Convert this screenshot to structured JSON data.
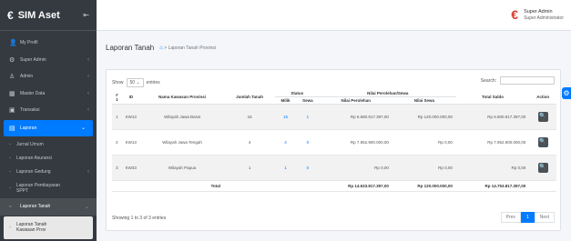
{
  "app": {
    "title": "SIM Aset",
    "logo_icon": "wallet-icon",
    "toggle": "⇤"
  },
  "user": {
    "name": "Super Admin",
    "role": "Super Administrator"
  },
  "sidebar": {
    "items": [
      {
        "label": "My Profil",
        "icon": "👤"
      },
      {
        "label": "Super Admin",
        "icon": "⚙",
        "chev": "‹"
      },
      {
        "label": "Admin",
        "icon": "♙",
        "chev": "‹"
      },
      {
        "label": "Master Data",
        "icon": "▦",
        "chev": "‹"
      },
      {
        "label": "Transaksi",
        "icon": "▣",
        "chev": "‹"
      },
      {
        "label": "Laporan",
        "icon": "▤",
        "chev": "⌄"
      }
    ],
    "subs": [
      {
        "label": "Jurnal Umum"
      },
      {
        "label": "Laporan Asuransi"
      },
      {
        "label": "Laporan Gedung",
        "chev": "‹"
      },
      {
        "label": "Laporan Pembayaran",
        "line2": "SPPT"
      }
    ],
    "open": {
      "label": "Laporan Tanah",
      "chev": "⌄"
    },
    "active": {
      "label": "Laporan Tanah",
      "line2": "Kawasan Prov"
    }
  },
  "page": {
    "title": "Laporan Tanah",
    "breadcrumb": "Laporan Tanah Provinsi"
  },
  "table_controls": {
    "show": "Show",
    "entries_value": "50",
    "entries": "entries",
    "search": "Search:"
  },
  "table": {
    "headers": {
      "no": "#",
      "id": "ID",
      "name": "Nama Kawasan Provinsi",
      "jumlah": "Jumlah Tanah",
      "status": "Status",
      "milik": "Milik",
      "sewa": "Sewa",
      "nilai": "Nilai Perolehan/Sewa",
      "perolehan": "Nilai Perolehan",
      "nilai_sewa": "Nilai Sewa",
      "total": "Total Saldo",
      "action": "Action",
      "sort_no": "1",
      "sort": "⇅"
    },
    "rows": [
      {
        "no": "1",
        "id": "KW13",
        "name": "Wilayah Jawa Barat",
        "jumlah": "16",
        "milik": "15",
        "sewa": "1",
        "perolehan": "Rp 6.680.917.397,00",
        "nilai_sewa": "Rp 120.000.000,00",
        "total": "Rp 6.800.917.397,00"
      },
      {
        "no": "2",
        "id": "KW13",
        "name": "Wilayah Jawa Tengah",
        "jumlah": "4",
        "milik": "4",
        "sewa": "0",
        "perolehan": "Rp 7.952.900.000,00",
        "nilai_sewa": "Rp 0,00",
        "total": "Rp 7.952.900.000,00"
      },
      {
        "no": "3",
        "id": "KW33",
        "name": "Wilayah Papua",
        "jumlah": "1",
        "milik": "1",
        "sewa": "0",
        "perolehan": "Rp 0,00",
        "nilai_sewa": "Rp 0,00",
        "total": "Rp 0,00"
      }
    ],
    "footer": {
      "label": "Total",
      "perolehan": "Rp 14.633.817.397,00",
      "nilai_sewa": "Rp 120.000.000,00",
      "total": "Rp 14.753.817.397,00"
    },
    "action_icon": "search-icon"
  },
  "info": "Showing 1 to 3 of 3 entries",
  "pager": {
    "prev": "Prev",
    "current": "1",
    "next": "Next"
  },
  "colors": {
    "sidebar": "#343a40",
    "accent": "#007bff",
    "logo": "#d63b2f"
  }
}
